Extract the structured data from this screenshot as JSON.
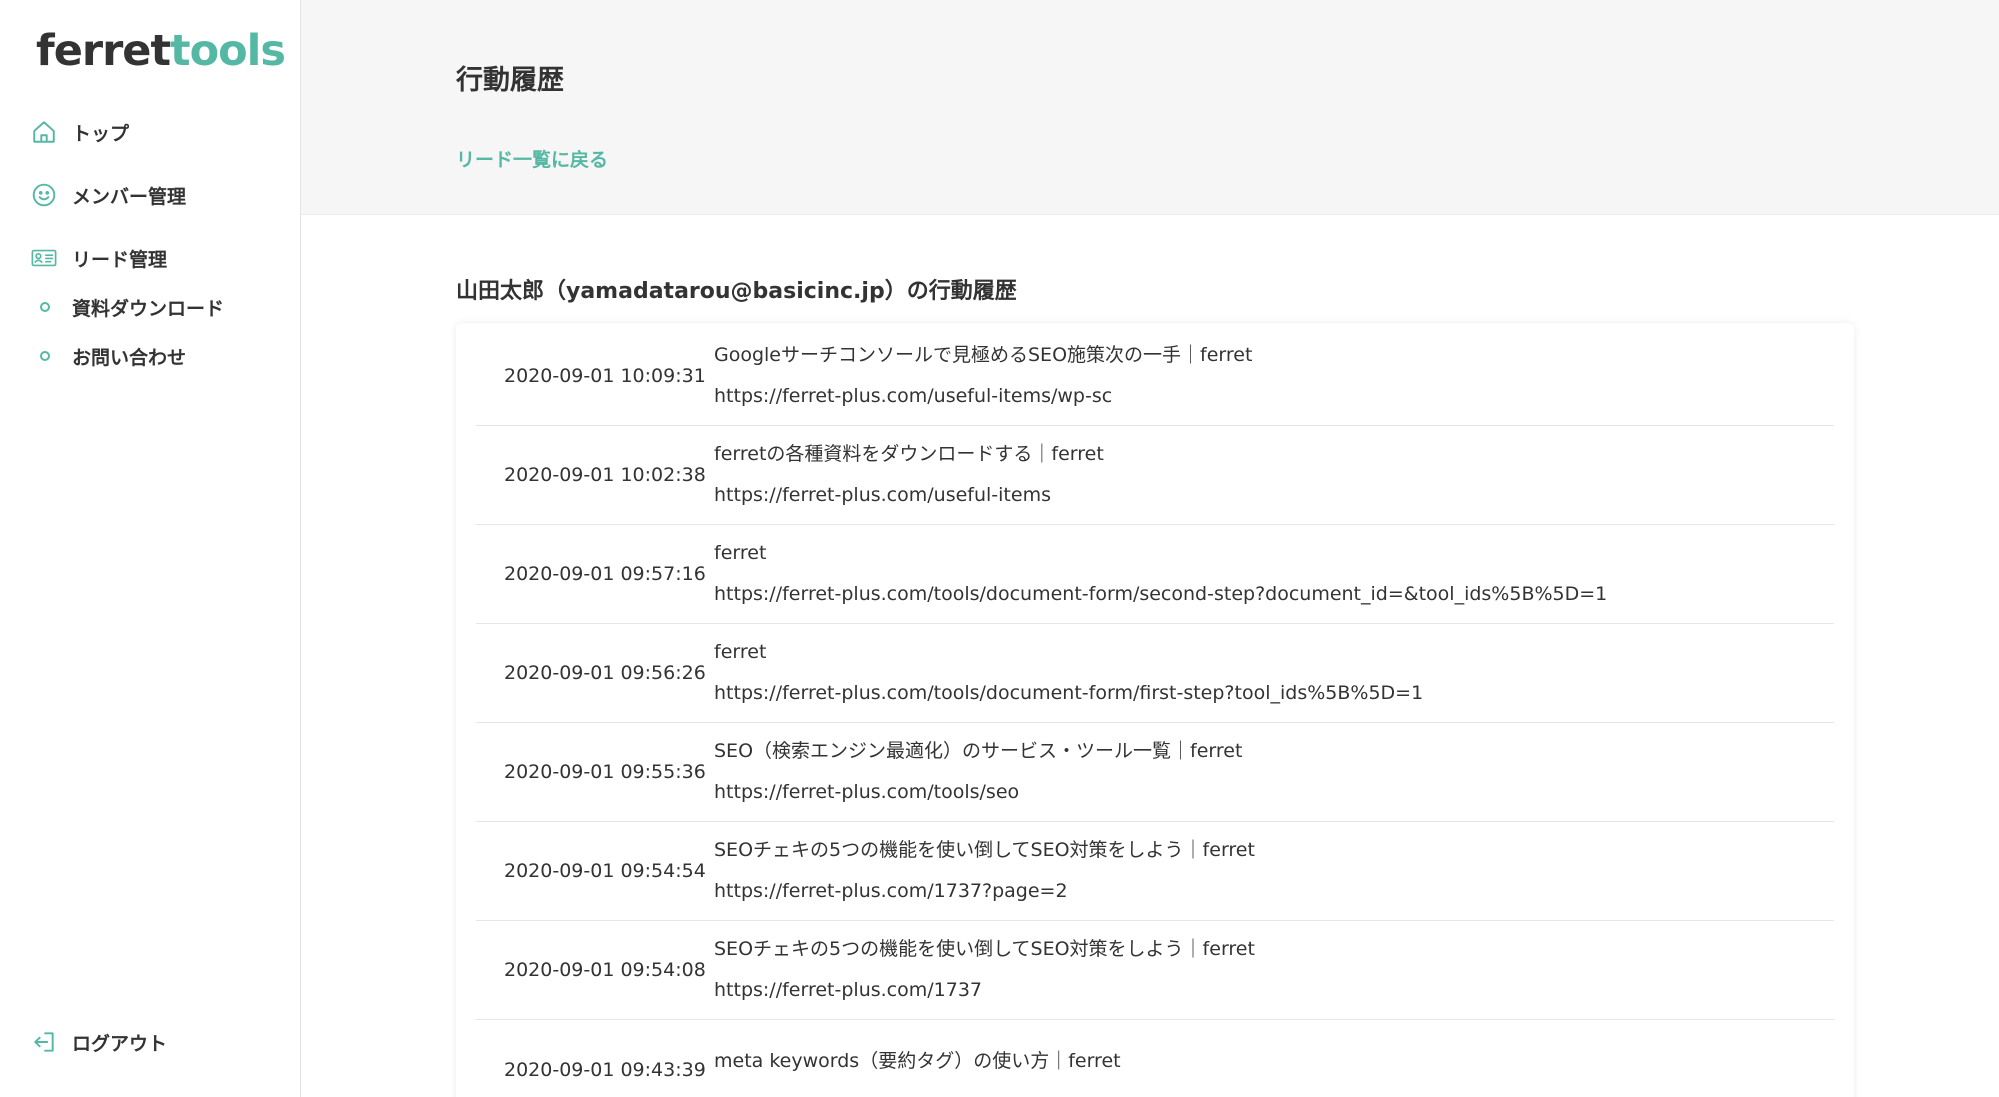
{
  "sidebar": {
    "logo": {
      "part1": "ferret",
      "part2": "tools"
    },
    "nav": [
      {
        "label": "トップ",
        "icon": "home-icon"
      },
      {
        "label": "メンバー管理",
        "icon": "smiley-icon"
      },
      {
        "label": "リード管理",
        "icon": "id-card-icon"
      }
    ],
    "subnav": [
      {
        "label": "資料ダウンロード"
      },
      {
        "label": "お問い合わせ"
      }
    ],
    "logout": {
      "label": "ログアウト",
      "icon": "logout-icon"
    }
  },
  "header": {
    "title": "行動履歴",
    "back_link": "リード一覧に戻る"
  },
  "main": {
    "section_title": "山田太郎（yamadatarou@basicinc.jp）の行動履歴",
    "rows": [
      {
        "time": "2020-09-01 10:09:31",
        "title": "Googleサーチコンソールで見極めるSEO施策次の一手｜ferret",
        "url": "https://ferret-plus.com/useful-items/wp-sc"
      },
      {
        "time": "2020-09-01 10:02:38",
        "title": "ferretの各種資料をダウンロードする｜ferret",
        "url": "https://ferret-plus.com/useful-items"
      },
      {
        "time": "2020-09-01 09:57:16",
        "title": "ferret",
        "url": "https://ferret-plus.com/tools/document-form/second-step?document_id=&tool_ids%5B%5D=1"
      },
      {
        "time": "2020-09-01 09:56:26",
        "title": "ferret",
        "url": "https://ferret-plus.com/tools/document-form/first-step?tool_ids%5B%5D=1"
      },
      {
        "time": "2020-09-01 09:55:36",
        "title": "SEO（検索エンジン最適化）のサービス・ツール一覧｜ferret",
        "url": "https://ferret-plus.com/tools/seo"
      },
      {
        "time": "2020-09-01 09:54:54",
        "title": "SEOチェキの5つの機能を使い倒してSEO対策をしよう｜ferret",
        "url": "https://ferret-plus.com/1737?page=2"
      },
      {
        "time": "2020-09-01 09:54:08",
        "title": "SEOチェキの5つの機能を使い倒してSEO対策をしよう｜ferret",
        "url": "https://ferret-plus.com/1737"
      },
      {
        "time": "2020-09-01 09:43:39",
        "title": "meta keywords（要約タグ）の使い方｜ferret",
        "url": ""
      }
    ]
  },
  "colors": {
    "accent": "#55b8a4",
    "text": "#333333",
    "header_bg": "#f6f6f6"
  }
}
